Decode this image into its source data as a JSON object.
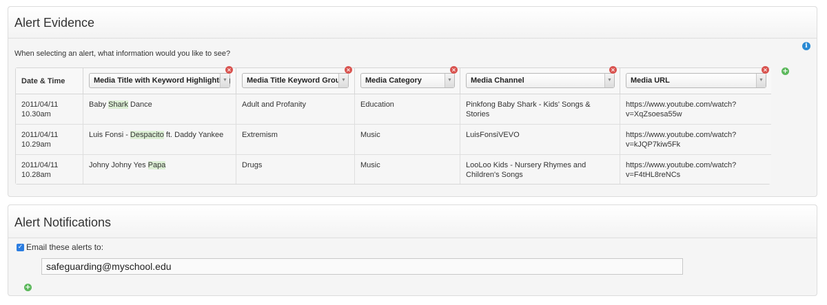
{
  "evidence": {
    "title": "Alert Evidence",
    "intro": "When selecting an alert, what information would you like to see?",
    "info_icon": "info-icon",
    "columns": {
      "date": "Date & Time",
      "c1": "Media Title with Keyword Highlighting",
      "c2": "Media Title Keyword Group",
      "c3": "Media Category",
      "c4": "Media Channel",
      "c5": "Media URL"
    },
    "rows": [
      {
        "date": "2011/04/11",
        "time": "10.30am",
        "title_pre": "Baby ",
        "title_kw": "Shark",
        "title_post": " Dance",
        "group": "Adult and Profanity",
        "category": "Education",
        "channel": "Pinkfong Baby Shark - Kids' Songs & Stories",
        "url1": "https://www.youtube.com/watch?",
        "url2": "v=XqZsoesa55w"
      },
      {
        "date": "2011/04/11",
        "time": "10.29am",
        "title_pre": "Luis Fonsi - ",
        "title_kw": "Despacito",
        "title_post": " ft. Daddy Yankee",
        "group": "Extremism",
        "category": "Music",
        "channel": "LuisFonsiVEVO",
        "url1": "https://www.youtube.com/watch?",
        "url2": "v=kJQP7kiw5Fk"
      },
      {
        "date": "2011/04/11",
        "time": "10.28am",
        "title_pre": "Johny Johny Yes ",
        "title_kw": "Papa",
        "title_post": "",
        "group": "Drugs",
        "category": "Music",
        "channel": "LooLoo Kids - Nursery Rhymes and Children's Songs",
        "url1": "https://www.youtube.com/watch?",
        "url2": "v=F4tHL8reNCs"
      }
    ],
    "remove_glyph": "×",
    "dropdown_glyph": "▼",
    "add_glyph": "+"
  },
  "notifications": {
    "title": "Alert Notifications",
    "email_label": "Email these alerts to:",
    "email_checked": true,
    "check_glyph": "✓",
    "email_value": "safeguarding@myschool.edu",
    "add_glyph": "+"
  },
  "colors": {
    "highlight": "#dcefd4",
    "remove": "#d9534f",
    "add": "#5cb85c",
    "info": "#2a8ad4",
    "checkbox": "#2b7de1"
  }
}
